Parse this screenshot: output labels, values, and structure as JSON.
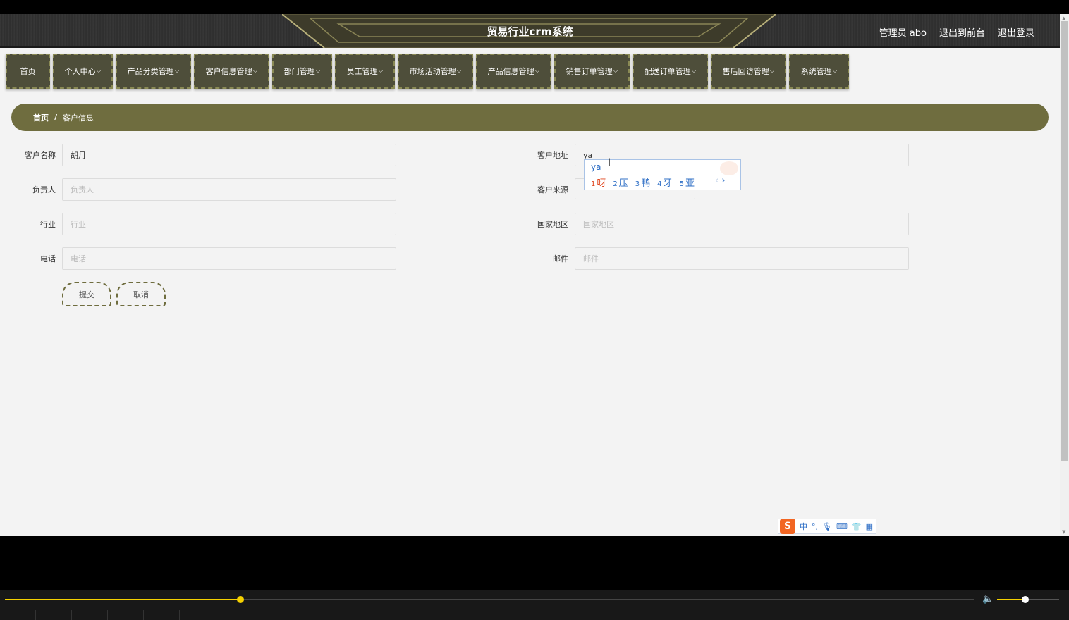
{
  "header": {
    "title": "贸易行业crm系统",
    "admin_label": "管理员 abo",
    "exit_front": "退出到前台",
    "logout": "退出登录"
  },
  "nav": {
    "items": [
      {
        "label": "首页",
        "has_chevron": false
      },
      {
        "label": "个人中心",
        "has_chevron": true
      },
      {
        "label": "产品分类管理",
        "has_chevron": true
      },
      {
        "label": "客户信息管理",
        "has_chevron": true
      },
      {
        "label": "部门管理",
        "has_chevron": true
      },
      {
        "label": "员工管理",
        "has_chevron": true
      },
      {
        "label": "市场活动管理",
        "has_chevron": true
      },
      {
        "label": "产品信息管理",
        "has_chevron": true
      },
      {
        "label": "销售订单管理",
        "has_chevron": true
      },
      {
        "label": "配送订单管理",
        "has_chevron": true
      },
      {
        "label": "售后回访管理",
        "has_chevron": true
      },
      {
        "label": "系统管理",
        "has_chevron": true
      }
    ]
  },
  "breadcrumb": {
    "home": "首页",
    "separator": "/",
    "current": "客户信息"
  },
  "form": {
    "customer_name": {
      "label": "客户名称",
      "value": "胡月",
      "placeholder": ""
    },
    "owner": {
      "label": "负责人",
      "value": "",
      "placeholder": "负责人"
    },
    "industry": {
      "label": "行业",
      "value": "",
      "placeholder": "行业"
    },
    "phone": {
      "label": "电话",
      "value": "",
      "placeholder": "电话"
    },
    "address": {
      "label": "客户地址",
      "value": "ya",
      "placeholder": ""
    },
    "source": {
      "label": "客户来源"
    },
    "region": {
      "label": "国家地区",
      "value": "",
      "placeholder": "国家地区"
    },
    "email": {
      "label": "邮件",
      "value": "",
      "placeholder": "邮件"
    },
    "submit_label": "提交",
    "cancel_label": "取消"
  },
  "ime": {
    "pinyin": "ya",
    "candidates": [
      {
        "num": "1",
        "char": "呀"
      },
      {
        "num": "2",
        "char": "压"
      },
      {
        "num": "3",
        "char": "鸭"
      },
      {
        "num": "4",
        "char": "牙"
      },
      {
        "num": "5",
        "char": "亚"
      }
    ],
    "prev": "‹",
    "next": "›",
    "toolbar": {
      "logo": "S",
      "mode": "中",
      "punct": "°,",
      "icons": [
        "microphone-icon",
        "keyboard-icon",
        "skin-icon",
        "grid-icon"
      ]
    }
  },
  "player": {
    "progress_fraction": 0.243,
    "volume_fraction": 0.45
  },
  "colors": {
    "accent": "#6f6d3f",
    "nav_bg": "#4e4e3a",
    "progress": "#f5d100"
  }
}
